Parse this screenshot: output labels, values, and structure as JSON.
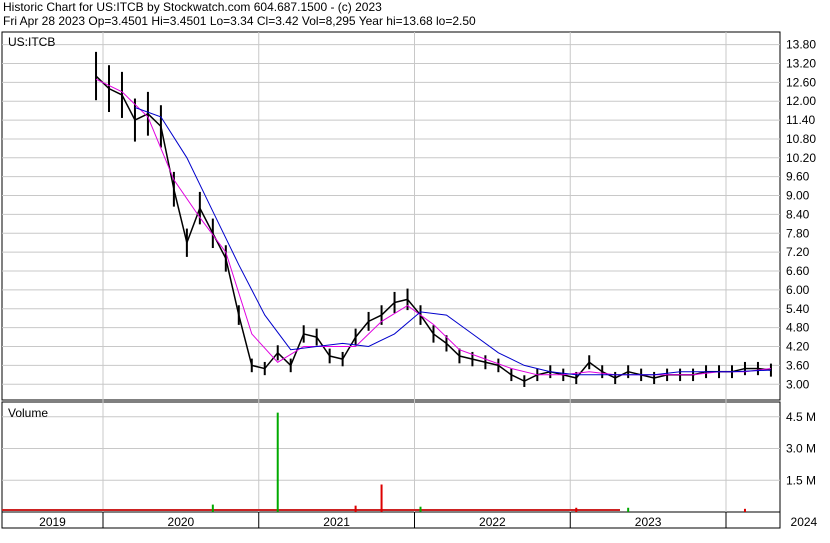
{
  "header": {
    "line1": "Historic Chart for US:ITCB by Stockwatch.com 604.687.1500 - (c) 2023",
    "line2": "Fri Apr 28 2023   Op=3.4501   Hi=3.4501   Lo=3.34   Cl=3.42   Vol=8,295   Year hi=13.68   lo=2.50"
  },
  "chart_data": [
    {
      "type": "line",
      "title": "US:ITCB",
      "ylim": [
        2.5,
        14.2
      ],
      "y_ticks": [
        "13.80",
        "13.20",
        "12.60",
        "12.00",
        "11.40",
        "10.80",
        "10.20",
        "9.60",
        "9.00",
        "8.40",
        "7.80",
        "7.20",
        "6.60",
        "6.00",
        "5.40",
        "4.80",
        "4.20",
        "3.60",
        "3.00"
      ],
      "x_ticks": [
        "2019",
        "2020",
        "2021",
        "2022",
        "2023",
        "2024"
      ],
      "grid": true,
      "series": [
        {
          "kind": "price-bars",
          "color": "#000000",
          "x": [
            "2018-12",
            "2019-01",
            "2019-02",
            "2019-03",
            "2019-04",
            "2019-05",
            "2019-06",
            "2019-07",
            "2019-08",
            "2019-09",
            "2019-10",
            "2019-11",
            "2019-12",
            "2020-01",
            "2020-02",
            "2020-03",
            "2020-04",
            "2020-05",
            "2020-06",
            "2020-07",
            "2020-08",
            "2020-09",
            "2020-10",
            "2020-11",
            "2020-12",
            "2021-01",
            "2021-02",
            "2021-03",
            "2021-04",
            "2021-05",
            "2021-06",
            "2021-07",
            "2021-08",
            "2021-09",
            "2021-10",
            "2021-11",
            "2021-12",
            "2022-01",
            "2022-02",
            "2022-03",
            "2022-04",
            "2022-05",
            "2022-06",
            "2022-07",
            "2022-08",
            "2022-09",
            "2022-10",
            "2022-11",
            "2022-12",
            "2023-01",
            "2023-02",
            "2023-03",
            "2023-04"
          ],
          "values": [
            12.8,
            12.4,
            12.2,
            11.4,
            11.6,
            11.2,
            9.2,
            7.5,
            8.6,
            7.8,
            7.0,
            5.2,
            3.6,
            3.5,
            4.0,
            3.6,
            4.6,
            4.5,
            3.9,
            3.8,
            4.5,
            5.0,
            5.2,
            5.6,
            5.7,
            5.2,
            4.6,
            4.3,
            3.9,
            3.8,
            3.7,
            3.6,
            3.3,
            3.1,
            3.3,
            3.4,
            3.3,
            3.2,
            3.7,
            3.4,
            3.2,
            3.4,
            3.3,
            3.2,
            3.3,
            3.3,
            3.3,
            3.4,
            3.4,
            3.4,
            3.5,
            3.5,
            3.45
          ]
        },
        {
          "kind": "moving-average-short",
          "color": "#e000e0",
          "x": [
            "2018-12",
            "2019-02",
            "2019-04",
            "2019-06",
            "2019-08",
            "2019-10",
            "2019-12",
            "2020-02",
            "2020-04",
            "2020-06",
            "2020-08",
            "2020-10",
            "2020-12",
            "2021-02",
            "2021-04",
            "2021-06",
            "2021-08",
            "2021-10",
            "2021-12",
            "2022-02",
            "2022-04",
            "2022-06",
            "2022-08",
            "2022-10",
            "2022-12",
            "2023-02",
            "2023-04"
          ],
          "values": [
            12.7,
            12.3,
            11.5,
            9.5,
            8.3,
            7.2,
            4.6,
            3.7,
            4.2,
            4.2,
            4.2,
            5.0,
            5.5,
            4.9,
            4.1,
            3.8,
            3.5,
            3.3,
            3.3,
            3.4,
            3.3,
            3.3,
            3.3,
            3.3,
            3.4,
            3.4,
            3.5
          ]
        },
        {
          "kind": "moving-average-long",
          "color": "#0000cc",
          "x": [
            "2019-03",
            "2019-05",
            "2019-07",
            "2019-09",
            "2019-11",
            "2020-01",
            "2020-03",
            "2020-05",
            "2020-07",
            "2020-09",
            "2020-11",
            "2021-01",
            "2021-03",
            "2021-05",
            "2021-07",
            "2021-09",
            "2021-11",
            "2022-01",
            "2022-03",
            "2022-05",
            "2022-07",
            "2022-09",
            "2022-11",
            "2023-01",
            "2023-04"
          ],
          "values": [
            11.8,
            11.5,
            10.2,
            8.5,
            6.8,
            5.2,
            4.1,
            4.2,
            4.3,
            4.2,
            4.6,
            5.3,
            5.2,
            4.6,
            4.0,
            3.6,
            3.4,
            3.3,
            3.3,
            3.3,
            3.3,
            3.4,
            3.4,
            3.4,
            3.45
          ]
        }
      ]
    },
    {
      "type": "bar",
      "title": "Volume",
      "ylim": [
        0,
        5.2
      ],
      "y_ticks": [
        "4.5 M",
        "3.0 M",
        "1.5 M"
      ],
      "x": [
        "2020-02",
        "2020-10",
        "2019-09",
        "2020-08",
        "2021-01",
        "2022-01",
        "2022-05",
        "2023-02"
      ],
      "values": [
        4.7,
        1.3,
        0.35,
        0.3,
        0.25,
        0.2,
        0.2,
        0.15
      ],
      "colors": [
        "#00aa00",
        "#dd0000",
        "#00aa00",
        "#dd0000",
        "#00aa00",
        "#dd0000",
        "#00aa00",
        "#dd0000"
      ]
    }
  ]
}
